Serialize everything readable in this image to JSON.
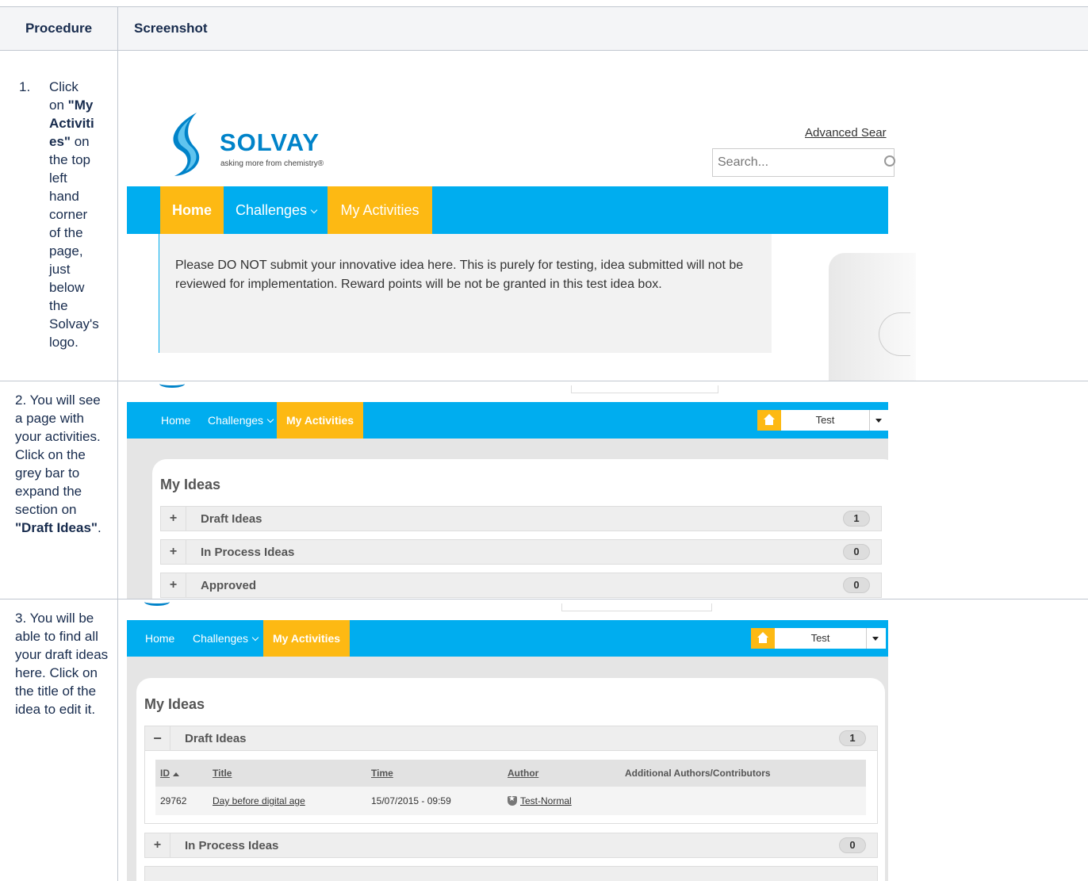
{
  "header": {
    "procedure": "Procedure",
    "screenshot": "Screenshot"
  },
  "steps": [
    {
      "num": "1.",
      "lines": [
        "Click",
        "on ",
        "\"My",
        "Activiti",
        "es\"",
        " on",
        "the top",
        "left",
        "hand",
        "corner",
        "of the",
        "page,",
        "just",
        "below",
        "the",
        "Solvay's",
        "logo."
      ]
    },
    {
      "text": "2. You will see a page with your activities. Click on the grey bar to expand the section on ",
      "bold": "\"Draft Ideas\"",
      "tail": "."
    },
    {
      "text": "3. You will be able to find all your draft ideas here. Click on the title of the idea to edit it."
    }
  ],
  "shot1": {
    "brand": "SOLVAY",
    "tagline": "asking more from chemistry®",
    "advanced_search": "Advanced Sear",
    "search_placeholder": "Search...",
    "nav": {
      "home": "Home",
      "challenges": "Challenges",
      "my_activities": "My Activities"
    },
    "banner": "Please DO NOT submit your innovative idea here.  This is purely for testing, idea submitted will not be reviewed for implementation. Reward points will be not be granted in this test idea box."
  },
  "shot2": {
    "nav": {
      "home": "Home",
      "challenges": "Challenges",
      "my_activities": "My Activities"
    },
    "user": "Test",
    "my_ideas": "My Ideas",
    "sections": [
      {
        "sign": "+",
        "label": "Draft Ideas",
        "count": "1"
      },
      {
        "sign": "+",
        "label": "In Process Ideas",
        "count": "0"
      },
      {
        "sign": "+",
        "label": "Approved",
        "count": "0"
      }
    ]
  },
  "shot3": {
    "nav": {
      "home": "Home",
      "challenges": "Challenges",
      "my_activities": "My Activities"
    },
    "user": "Test",
    "my_ideas": "My Ideas",
    "draft": {
      "sign": "−",
      "label": "Draft Ideas",
      "count": "1"
    },
    "columns": [
      "ID",
      "Title",
      "Time",
      "Author",
      "Additional Authors/Contributors"
    ],
    "rows": [
      {
        "id": "29762",
        "title": "Day before digital age",
        "time": "15/07/2015 - 09:59",
        "author": "Test-Normal",
        "contributors": ""
      }
    ],
    "in_process": {
      "sign": "+",
      "label": "In Process Ideas",
      "count": "0"
    }
  }
}
